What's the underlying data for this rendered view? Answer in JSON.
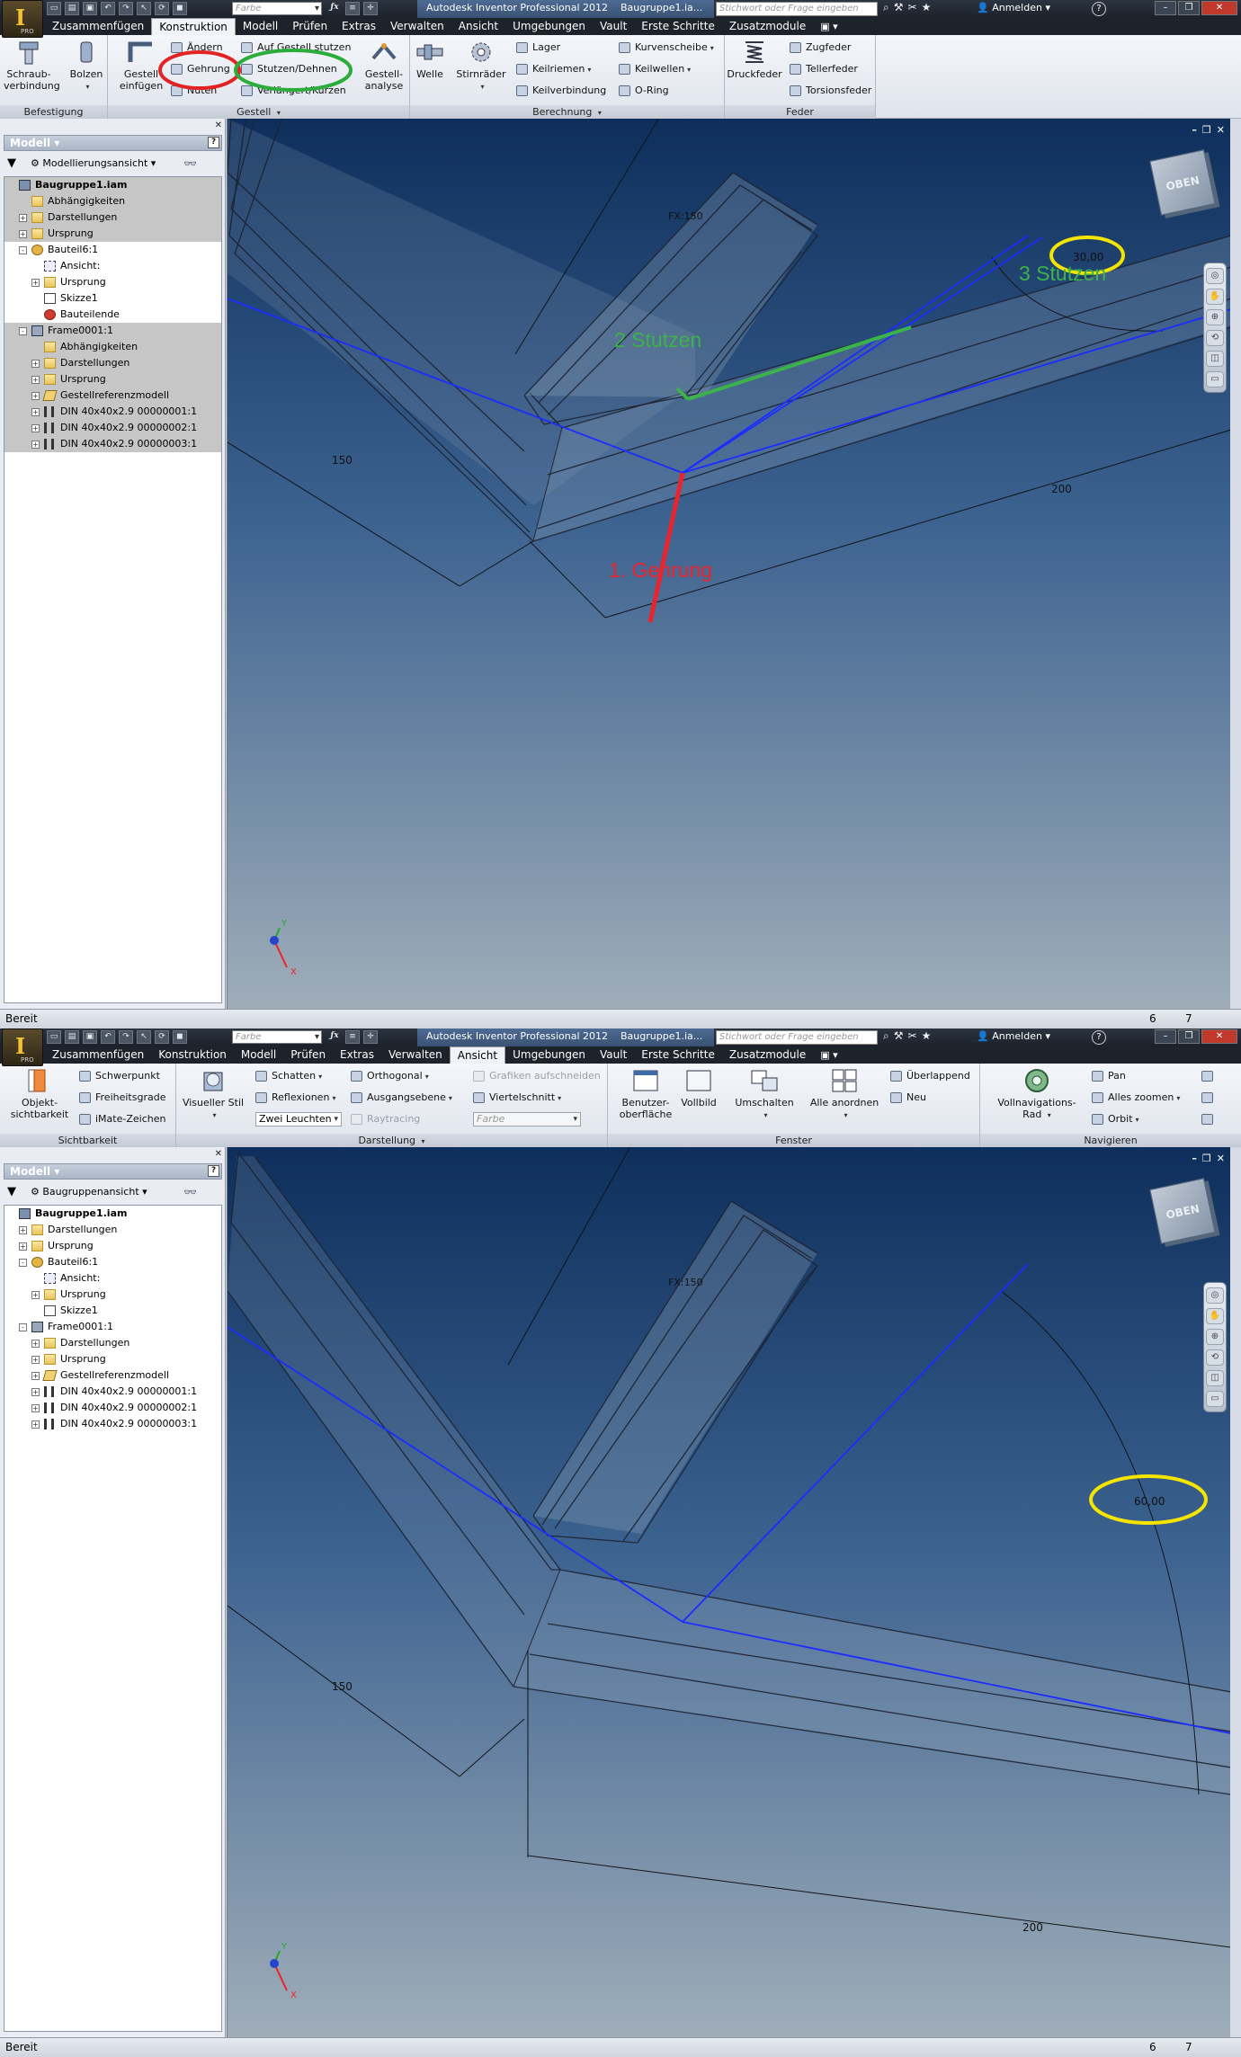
{
  "shots": [
    {
      "titlebar": {
        "app_title": "Autodesk Inventor Professional 2012",
        "doc_title": "Baugruppe1.ia...",
        "color_placeholder": "Farbe",
        "search_placeholder": "Stichwort oder Frage eingeben",
        "signin": "Anmelden"
      },
      "tabs": [
        "Zusammenfügen",
        "Konstruktion",
        "Modell",
        "Prüfen",
        "Extras",
        "Verwalten",
        "Ansicht",
        "Umgebungen",
        "Vault",
        "Erste Schritte",
        "Zusatzmodule"
      ],
      "active_tab": "Konstruktion",
      "ribbon": {
        "befestigung": {
          "title": "Befestigung",
          "schraub": "Schraub-",
          "verbindung": "verbindung",
          "bolzen": "Bolzen"
        },
        "gestell": {
          "title": "Gestell",
          "einfuegen1": "Gestell",
          "einfuegen2": "einfügen",
          "aendern": "Ändern",
          "gehrung": "Gehrung",
          "nuten": "Nuten",
          "auf_gestell": "Auf Gestell stutzen",
          "stutzen": "Stutzen/Dehnen",
          "verlaengert": "Verlängert/Kürzen",
          "analyse1": "Gestell-",
          "analyse2": "analyse"
        },
        "berechnung": {
          "title": "Berechnung",
          "welle": "Welle",
          "stirnraeder": "Stirnräder",
          "lager": "Lager",
          "keilriemen": "Keilriemen",
          "keilverbindung": "Keilverbindung",
          "kurvenscheibe": "Kurvenscheibe",
          "keilwellen": "Keilwellen",
          "oring": "O-Ring"
        },
        "feder": {
          "title": "Feder",
          "druckfeder": "Druckfeder",
          "zugfeder": "Zugfeder",
          "tellerfeder": "Tellerfeder",
          "torsionsfeder": "Torsionsfeder"
        }
      },
      "browser": {
        "title": "Modell",
        "view": "Modellierungsansicht",
        "tree": [
          {
            "label": "Baugruppe1.iam",
            "bold": true,
            "indent": 0,
            "icon": "assembly-icon",
            "sel": true
          },
          {
            "label": "Abhängigkeiten",
            "indent": 1,
            "icon": "folder-icon",
            "sel": true
          },
          {
            "label": "Darstellungen",
            "indent": 1,
            "icon": "folder-icon",
            "exp": "+",
            "sel": true
          },
          {
            "label": "Ursprung",
            "indent": 1,
            "icon": "folder-icon",
            "exp": "+",
            "sel": true
          },
          {
            "label": "Bauteil6:1",
            "indent": 1,
            "icon": "part-icon",
            "exp": "-"
          },
          {
            "label": "Ansicht:",
            "indent": 2,
            "icon": "view-icon"
          },
          {
            "label": "Ursprung",
            "indent": 2,
            "icon": "folder-icon",
            "exp": "+"
          },
          {
            "label": "Skizze1",
            "indent": 2,
            "icon": "sketch-icon"
          },
          {
            "label": "Bauteilende",
            "indent": 2,
            "icon": "end-of-part-icon"
          },
          {
            "label": "Frame0001:1",
            "indent": 1,
            "icon": "frame-icon",
            "exp": "-",
            "sel": true
          },
          {
            "label": "Abhängigkeiten",
            "indent": 2,
            "icon": "folder-icon",
            "sel": true
          },
          {
            "label": "Darstellungen",
            "indent": 2,
            "icon": "folder-icon",
            "exp": "+",
            "sel": true
          },
          {
            "label": "Ursprung",
            "indent": 2,
            "icon": "folder-icon",
            "exp": "+",
            "sel": true
          },
          {
            "label": "Gestellreferenzmodell",
            "indent": 2,
            "icon": "frame-reference-icon",
            "exp": "+",
            "sel": true
          },
          {
            "label": "DIN 40x40x2.9 00000001:1",
            "indent": 2,
            "icon": "ibeam-icon",
            "exp": "+",
            "sel": true
          },
          {
            "label": "DIN 40x40x2.9 00000002:1",
            "indent": 2,
            "icon": "ibeam-icon",
            "exp": "+",
            "sel": true
          },
          {
            "label": "DIN 40x40x2.9 00000003:1",
            "indent": 2,
            "icon": "ibeam-icon",
            "exp": "+",
            "sel": true
          }
        ]
      },
      "viewport": {
        "cube_label": "OBEN",
        "dims": {
          "fx150": "FX:150",
          "d150": "150",
          "d200": "200",
          "angle": "30,00"
        },
        "annotations": {
          "miter": "1. Gehrung",
          "notch2": "2 Stutzen",
          "notch3": "3 Stutzen"
        },
        "colors": {
          "miter": "#e8252f",
          "notch": "#3cb34a",
          "highlight": "#f4e400",
          "axis_line": "#1a2cff"
        },
        "axis_labels": {
          "x": "X",
          "y": "Y"
        }
      },
      "status": {
        "text": "Bereit",
        "n1": "6",
        "n2": "7"
      }
    },
    {
      "titlebar": {
        "app_title": "Autodesk Inventor Professional 2012",
        "doc_title": "Baugruppe1.ia...",
        "color_placeholder": "Farbe",
        "search_placeholder": "Stichwort oder Frage eingeben",
        "signin": "Anmelden"
      },
      "tabs": [
        "Zusammenfügen",
        "Konstruktion",
        "Modell",
        "Prüfen",
        "Extras",
        "Verwalten",
        "Ansicht",
        "Umgebungen",
        "Vault",
        "Erste Schritte",
        "Zusatzmodule"
      ],
      "active_tab": "Ansicht",
      "ribbon": {
        "sichtbarkeit": {
          "title": "Sichtbarkeit",
          "objekt1": "Objekt-",
          "objekt2": "sichtbarkeit",
          "schwerpunkt": "Schwerpunkt",
          "freiheitsgrade": "Freiheitsgrade",
          "imate": "iMate-Zeichen"
        },
        "darstellung": {
          "title": "Darstellung",
          "visueller_stil": "Visueller Stil",
          "schatten": "Schatten",
          "reflexionen": "Reflexionen",
          "zwei_leuchten": "Zwei Leuchten",
          "orthogonal": "Orthogonal",
          "ausgangsebene": "Ausgangsebene",
          "raytracing": "Raytracing",
          "grafiken": "Grafiken aufschneiden",
          "viertelschnitt": "Viertelschnitt",
          "farbe": "Farbe"
        },
        "fenster": {
          "title": "Fenster",
          "benutzer1": "Benutzer-",
          "benutzer2": "oberfläche",
          "vollbild": "Vollbild",
          "umschalten": "Umschalten",
          "alle_anordnen": "Alle anordnen",
          "ueberlappend": "Überlappend",
          "neu": "Neu"
        },
        "navigieren": {
          "title": "Navigieren",
          "vollnav1": "Vollnavigations-",
          "vollnav2": "Rad",
          "pan": "Pan",
          "alles_zoomen": "Alles zoomen",
          "orbit": "Orbit"
        }
      },
      "browser": {
        "title": "Modell",
        "view": "Baugruppenansicht",
        "tree": [
          {
            "label": "Baugruppe1.iam",
            "bold": true,
            "indent": 0,
            "icon": "assembly-icon"
          },
          {
            "label": "Darstellungen",
            "indent": 1,
            "icon": "folder-icon",
            "exp": "+"
          },
          {
            "label": "Ursprung",
            "indent": 1,
            "icon": "folder-icon",
            "exp": "+"
          },
          {
            "label": "Bauteil6:1",
            "indent": 1,
            "icon": "part-icon",
            "exp": "-"
          },
          {
            "label": "Ansicht:",
            "indent": 2,
            "icon": "view-icon"
          },
          {
            "label": "Ursprung",
            "indent": 2,
            "icon": "folder-icon",
            "exp": "+"
          },
          {
            "label": "Skizze1",
            "indent": 2,
            "icon": "sketch-icon"
          },
          {
            "label": "Frame0001:1",
            "indent": 1,
            "icon": "frame-icon",
            "exp": "-"
          },
          {
            "label": "Darstellungen",
            "indent": 2,
            "icon": "folder-icon",
            "exp": "+"
          },
          {
            "label": "Ursprung",
            "indent": 2,
            "icon": "folder-icon",
            "exp": "+"
          },
          {
            "label": "Gestellreferenzmodell",
            "indent": 2,
            "icon": "frame-reference-icon",
            "exp": "+"
          },
          {
            "label": "DIN 40x40x2.9 00000001:1",
            "indent": 2,
            "icon": "ibeam-icon",
            "exp": "+"
          },
          {
            "label": "DIN 40x40x2.9 00000002:1",
            "indent": 2,
            "icon": "ibeam-icon",
            "exp": "+"
          },
          {
            "label": "DIN 40x40x2.9 00000003:1",
            "indent": 2,
            "icon": "ibeam-icon",
            "exp": "+"
          }
        ]
      },
      "viewport": {
        "cube_label": "OBEN",
        "dims": {
          "fx150": "FX:150",
          "d150": "150",
          "d200": "200",
          "angle": "60,00"
        },
        "colors": {
          "highlight": "#f4e400",
          "axis_line": "#1a2cff"
        },
        "axis_labels": {
          "x": "X",
          "y": "Y"
        }
      },
      "status": {
        "text": "Bereit",
        "n1": "6",
        "n2": "7"
      }
    }
  ]
}
